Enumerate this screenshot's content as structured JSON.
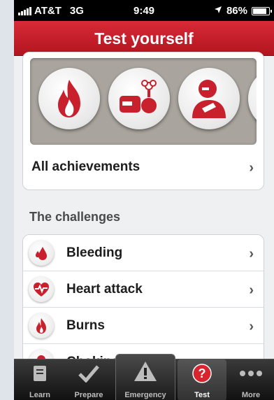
{
  "status_bar": {
    "carrier": "AT&T",
    "network": "3G",
    "time": "9:49",
    "battery_text": "86%",
    "battery_level": 0.86
  },
  "header": {
    "title": "Test yourself"
  },
  "achievements": {
    "badges": [
      "fire-badge-icon",
      "gas-bottle-badge-icon",
      "choking-badge-icon",
      "partial-badge-icon"
    ],
    "all_label": "All achievements"
  },
  "challenges": {
    "section_title": "The challenges",
    "items": [
      {
        "label": "Bleeding",
        "icon": "blood-drop-icon"
      },
      {
        "label": "Heart attack",
        "icon": "heart-icon"
      },
      {
        "label": "Burns",
        "icon": "flame-icon"
      },
      {
        "label": "Choking",
        "icon": "choking-icon"
      }
    ]
  },
  "tabs": [
    {
      "label": "Learn",
      "icon": "book-icon"
    },
    {
      "label": "Prepare",
      "icon": "check-icon"
    },
    {
      "label": "Emergency",
      "icon": "warning-icon"
    },
    {
      "label": "Test",
      "icon": "question-icon",
      "active": true
    },
    {
      "label": "More",
      "icon": "more-dots-icon"
    }
  ],
  "colors": {
    "brand_red": "#c8202c",
    "background": "#eef0f2"
  }
}
